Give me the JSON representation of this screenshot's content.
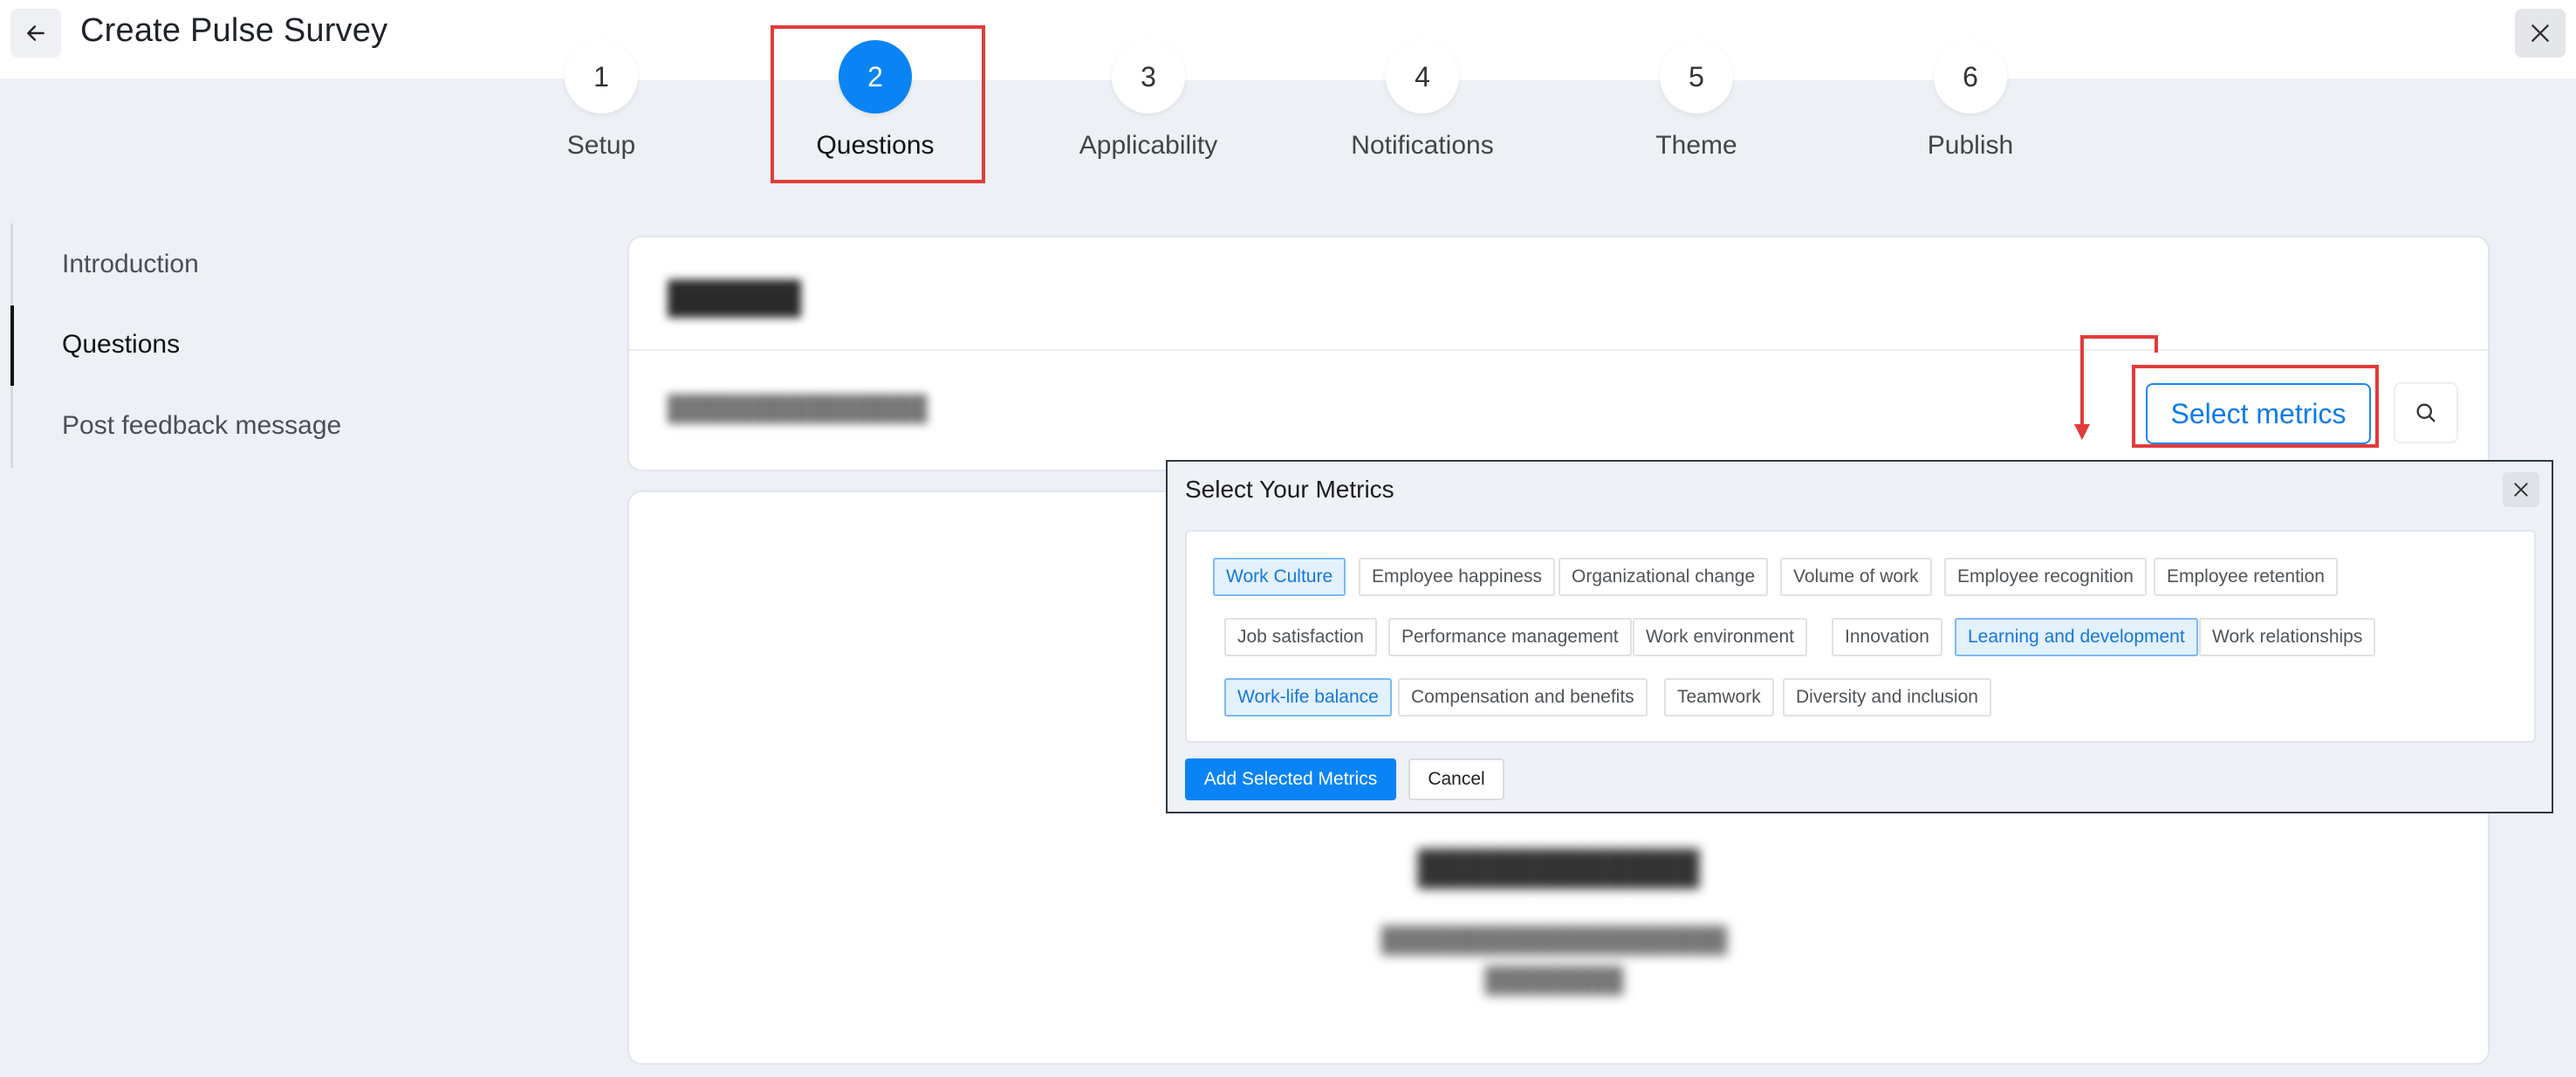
{
  "header": {
    "title": "Create Pulse Survey",
    "back_icon": "arrow-left-icon",
    "close_icon": "close-icon"
  },
  "stepper": {
    "steps": [
      {
        "number": "1",
        "label": "Setup",
        "active": false
      },
      {
        "number": "2",
        "label": "Questions",
        "active": true
      },
      {
        "number": "3",
        "label": "Applicability",
        "active": false
      },
      {
        "number": "4",
        "label": "Notifications",
        "active": false
      },
      {
        "number": "5",
        "label": "Theme",
        "active": false
      },
      {
        "number": "6",
        "label": "Publish",
        "active": false
      }
    ]
  },
  "sidebar": {
    "items": [
      {
        "label": "Introduction",
        "active": false
      },
      {
        "label": "Questions",
        "active": true
      },
      {
        "label": "Post feedback message",
        "active": false
      }
    ]
  },
  "questions_card": {
    "select_metrics_label": "Select metrics",
    "search_icon": "search-icon"
  },
  "modal": {
    "title": "Select Your Metrics",
    "close_icon": "close-icon",
    "metrics": [
      {
        "label": "Work Culture",
        "selected": true
      },
      {
        "label": "Employee happiness",
        "selected": false
      },
      {
        "label": "Organizational change",
        "selected": false
      },
      {
        "label": "Volume of work",
        "selected": false
      },
      {
        "label": "Employee recognition",
        "selected": false
      },
      {
        "label": "Employee retention",
        "selected": false
      },
      {
        "label": "Job satisfaction",
        "selected": false
      },
      {
        "label": "Performance management",
        "selected": false
      },
      {
        "label": "Work environment",
        "selected": false
      },
      {
        "label": "Innovation",
        "selected": false
      },
      {
        "label": "Learning and development",
        "selected": true
      },
      {
        "label": "Work relationships",
        "selected": false
      },
      {
        "label": "Work-life balance",
        "selected": true
      },
      {
        "label": "Compensation and benefits",
        "selected": false
      },
      {
        "label": "Teamwork",
        "selected": false
      },
      {
        "label": "Diversity and inclusion",
        "selected": false
      }
    ],
    "add_label": "Add Selected Metrics",
    "cancel_label": "Cancel"
  },
  "colors": {
    "accent": "#0a84f5",
    "annotation": "#e23b3b",
    "background": "#edf0f5"
  }
}
